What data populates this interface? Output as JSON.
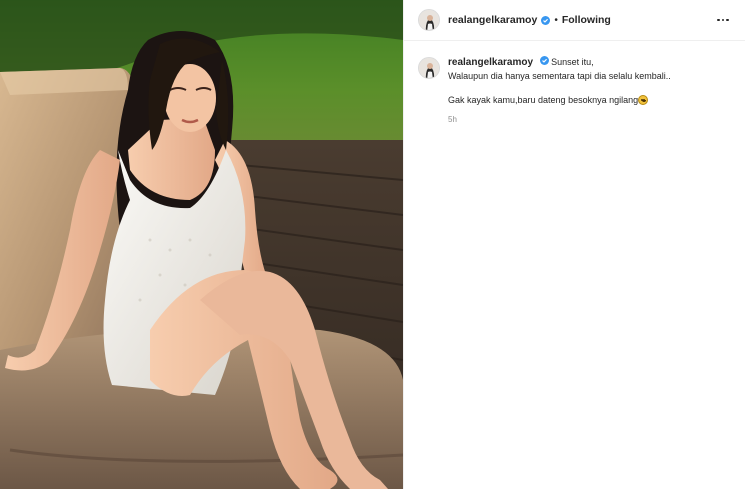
{
  "post": {
    "photo": {
      "description_icon": "post-photo"
    },
    "header": {
      "username": "realangelkaramoy",
      "separator": "•",
      "follow_status": "Following",
      "more_icon": "more-horizontal-icon",
      "verified_icon": "verified-badge-icon"
    },
    "caption": {
      "username": "realangelkaramoy",
      "line1": "Sunset itu,",
      "line2": "Walaupun dia hanya sementara tapi dia selalu kembali..",
      "line3": "Gak kayak kamu,baru dateng besoknya ngilang",
      "emoji_icon": "grimacing-face-emoji",
      "timestamp": "5h"
    },
    "colors": {
      "verified": "#3897f0",
      "text": "#262626",
      "muted": "#8e8e8e",
      "divider": "#efefef"
    }
  }
}
